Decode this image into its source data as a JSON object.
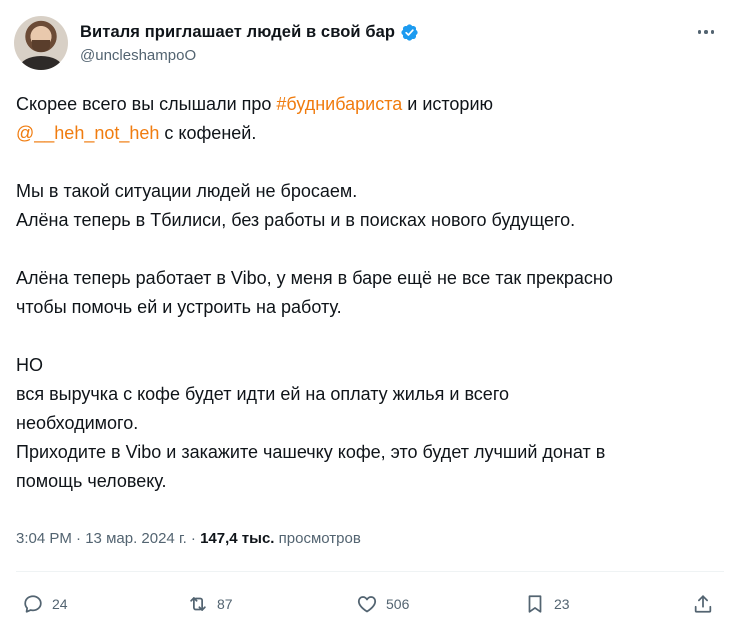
{
  "author": {
    "display_name": "Виталя приглашает людей в свой бар",
    "handle": "@uncleshampoO"
  },
  "tweet": {
    "line1_pre": "Скорее всего вы слышали про ",
    "line1_hashtag": "#буднибариста",
    "line1_post": " и историю",
    "line2_mention": "@__heh_not_heh",
    "line2_post": " с кофеней.",
    "line3": "Мы в такой ситуации людей не бросаем.",
    "line4": "Алёна теперь в Тбилиси, без работы и в поисках нового будущего.",
    "line5": "Алёна теперь работает в Vibo, у меня в баре ещё не все так прекрасно",
    "line6": "чтобы помочь ей и устроить на работу.",
    "line7": "НО",
    "line8": "вся выручка с кофе будет идти ей на оплату жилья и всего",
    "line9": "необходимого.",
    "line10": "Приходите в Vibo и закажите чашечку кофе, это будет лучший донат в",
    "line11": "помощь человеку."
  },
  "meta": {
    "time": "3:04 PM",
    "separator1": " · ",
    "date": "13 мар. 2024 г.",
    "separator2": " · ",
    "views_count": "147,4 тыс.",
    "views_label": " просмотров"
  },
  "actions": {
    "replies": "24",
    "reposts": "87",
    "likes": "506",
    "bookmarks": "23"
  },
  "icons": {
    "verified": "verified-badge-icon",
    "more": "more-icon",
    "reply": "reply-icon",
    "repost": "repost-icon",
    "like": "like-icon",
    "bookmark": "bookmark-icon",
    "share": "share-icon"
  },
  "colors": {
    "link": "#f07c0f",
    "verified": "#1d9bf0",
    "secondary_text": "#536471"
  }
}
